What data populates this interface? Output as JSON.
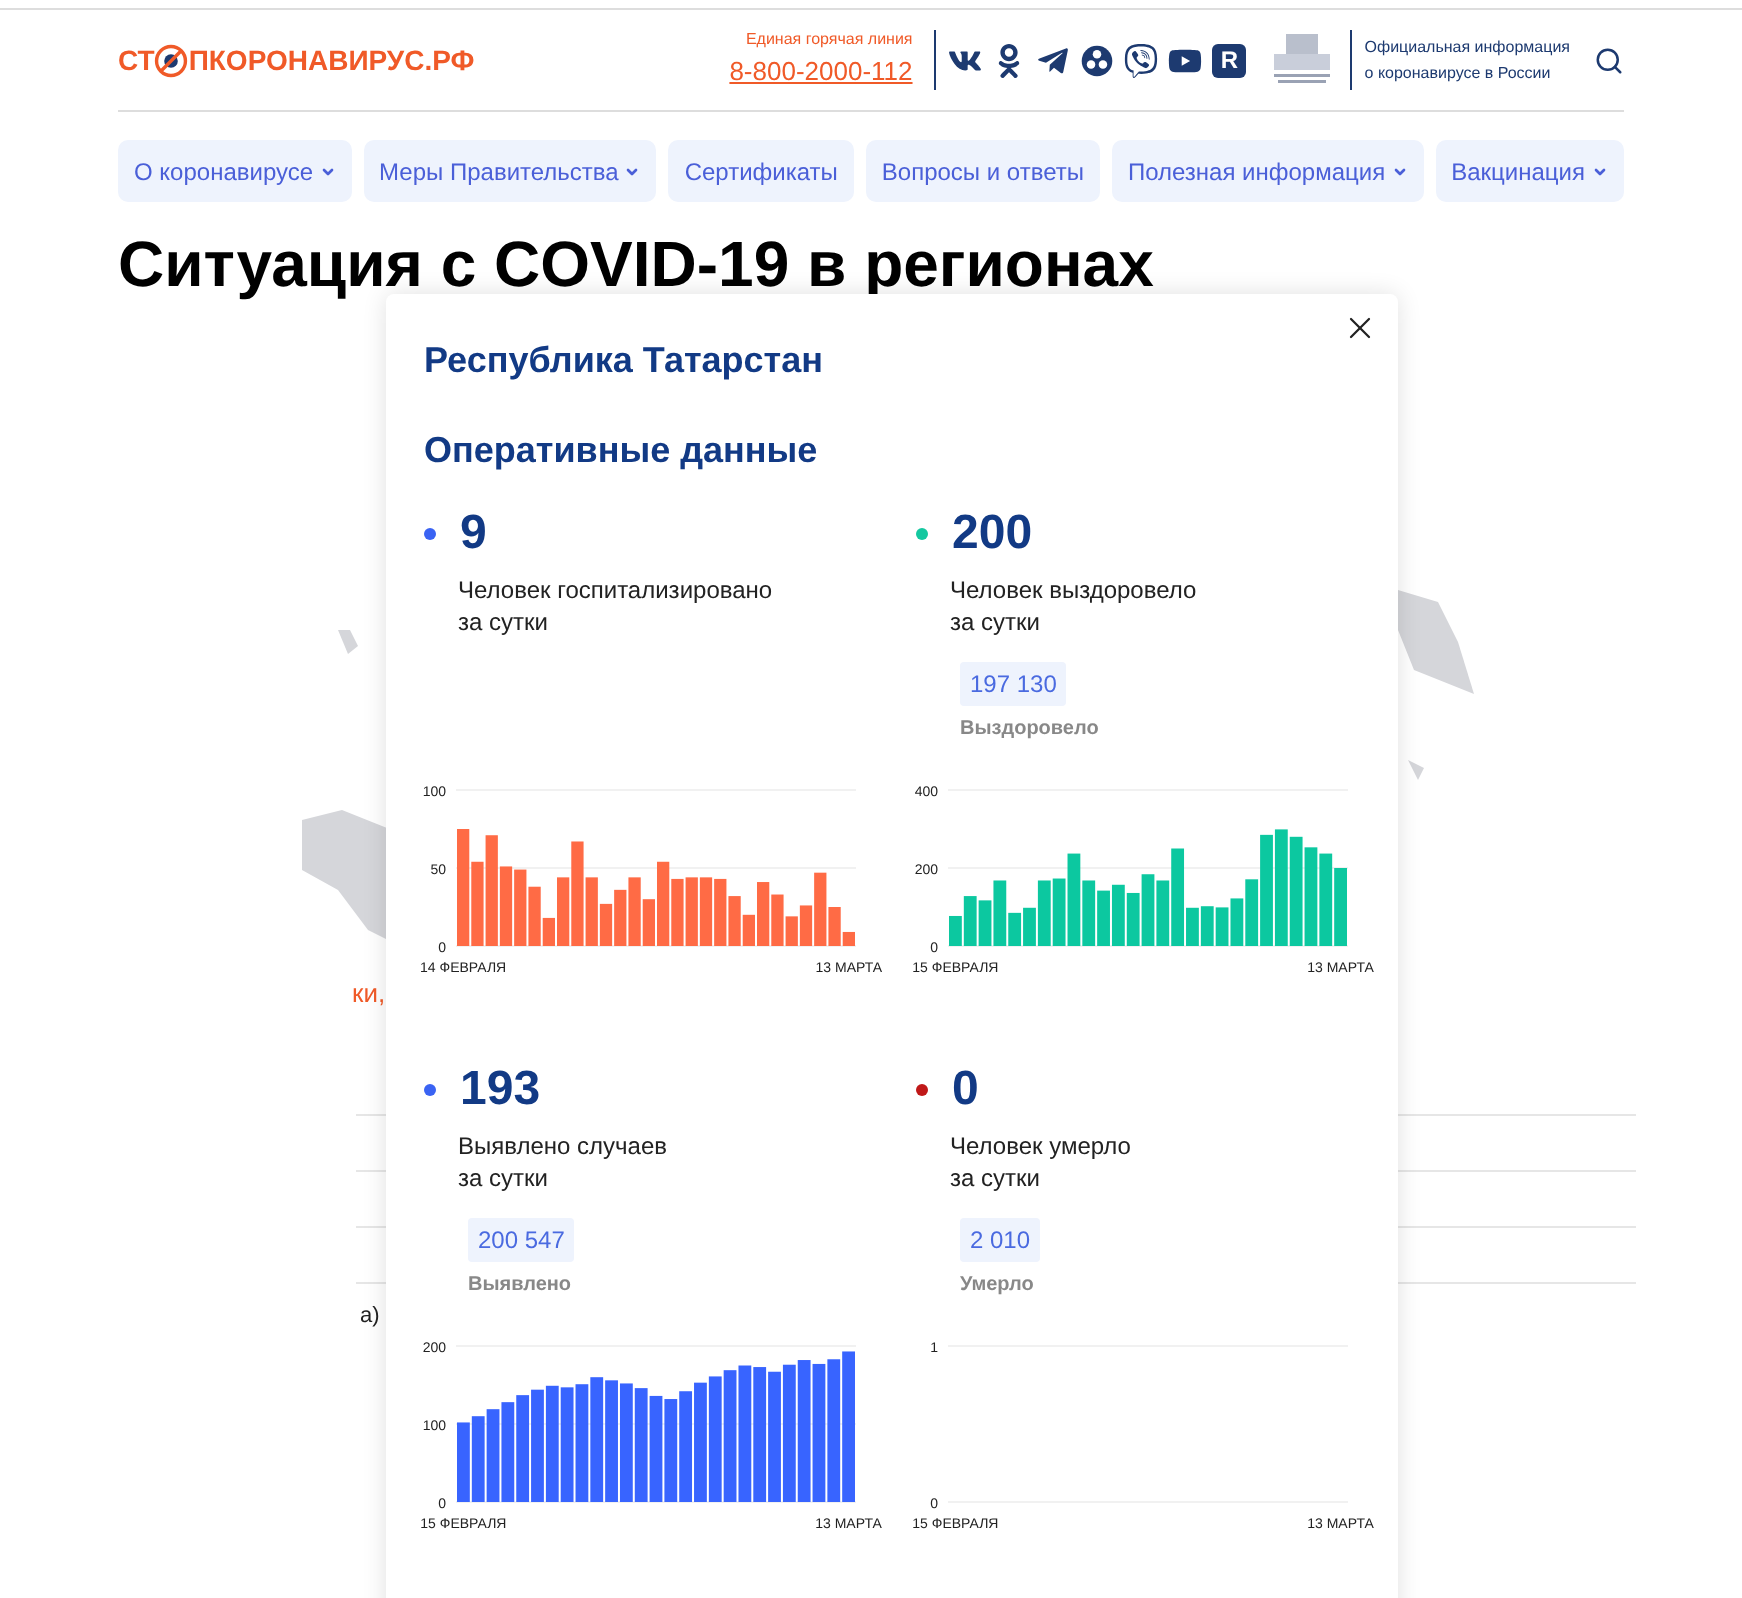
{
  "header": {
    "logo": {
      "start": "СТ",
      "rest": "ПКОРОНАВИРУС.РФ"
    },
    "hotline": {
      "label": "Единая горячая линия",
      "phone": "8-800-2000-112"
    },
    "socials": [
      {
        "kind": "vk"
      },
      {
        "kind": "ok"
      },
      {
        "kind": "telegram"
      },
      {
        "kind": "flower"
      },
      {
        "kind": "viber"
      },
      {
        "kind": "youtube"
      },
      {
        "kind": "letter",
        "text": "R"
      }
    ],
    "official_info": "Официальная информация\nо коронавирусе в России"
  },
  "nav": [
    {
      "label": "О коронавирусе",
      "dropdown": true
    },
    {
      "label": "Меры Правительства",
      "dropdown": true
    },
    {
      "label": "Сертификаты",
      "dropdown": false
    },
    {
      "label": "Вопросы и ответы",
      "dropdown": false
    },
    {
      "label": "Полезная информация",
      "dropdown": true
    },
    {
      "label": "Вакцинация",
      "dropdown": true
    }
  ],
  "page_title": "Ситуация с COVID-19 в регионах",
  "background_fragments": [
    "ки,",
    "а)"
  ],
  "modal": {
    "title": "Республика Татарстан",
    "section": "Оперативные данные",
    "stats": [
      {
        "number": "9",
        "label": "Человек госпитализировано\nза сутки",
        "color": "#3a63f3",
        "chart_data": {
          "type": "bar",
          "ylim": [
            0,
            100
          ],
          "yticks": [
            0,
            50,
            100
          ],
          "categories": [
            "14 ФЕВРАЛЯ",
            null,
            null,
            null,
            null,
            null,
            null,
            null,
            null,
            null,
            null,
            null,
            null,
            null,
            null,
            null,
            null,
            null,
            null,
            null,
            null,
            null,
            null,
            null,
            null,
            null,
            null,
            "13 МАРТА"
          ],
          "series": [
            {
              "color": "#ff6b45",
              "values": [
                75,
                54,
                71,
                51,
                49,
                38,
                18,
                44,
                67,
                44,
                27,
                36,
                44,
                30,
                54,
                43,
                44,
                44,
                43,
                32,
                20,
                41,
                33,
                19,
                26,
                47,
                25,
                9
              ]
            }
          ]
        }
      },
      {
        "number": "200",
        "label": "Человек выздоровело\nза сутки",
        "color": "#14c8a0",
        "total": "197 130",
        "total_label": "Выздоровело",
        "chart_data": {
          "type": "bar",
          "ylim": [
            0,
            400
          ],
          "yticks": [
            0,
            200,
            400
          ],
          "categories": [
            "15 ФЕВРАЛЯ",
            null,
            null,
            null,
            null,
            null,
            null,
            null,
            null,
            null,
            null,
            null,
            null,
            null,
            null,
            null,
            null,
            null,
            null,
            null,
            null,
            null,
            null,
            null,
            null,
            null,
            "13 МАРТА"
          ],
          "series": [
            {
              "color": "#0cc8a0",
              "values": [
                77,
                128,
                117,
                168,
                85,
                98,
                168,
                173,
                237,
                168,
                142,
                157,
                136,
                184,
                168,
                250,
                98,
                102,
                99,
                122,
                171,
                285,
                299,
                280,
                253,
                237,
                200
              ]
            }
          ]
        }
      },
      {
        "number": "193",
        "label": "Выявлено случаев\nза сутки",
        "color": "#3a63f3",
        "total": "200 547",
        "total_label": "Выявлено",
        "chart_data": {
          "type": "bar",
          "ylim": [
            0,
            200
          ],
          "yticks": [
            0,
            100,
            200
          ],
          "categories": [
            "15 ФЕВРАЛЯ",
            null,
            null,
            null,
            null,
            null,
            null,
            null,
            null,
            null,
            null,
            null,
            null,
            null,
            null,
            null,
            null,
            null,
            null,
            null,
            null,
            null,
            null,
            null,
            null,
            null,
            "13 МАРТА"
          ],
          "series": [
            {
              "color": "#3864ff",
              "values": [
                102,
                110,
                119,
                128,
                137,
                144,
                149,
                147,
                151,
                160,
                156,
                152,
                146,
                136,
                132,
                142,
                153,
                161,
                169,
                175,
                173,
                167,
                176,
                182,
                177,
                183,
                193
              ]
            }
          ]
        }
      },
      {
        "number": "0",
        "label": "Человек умерло\nза сутки",
        "color": "#c01818",
        "total": "2 010",
        "total_label": "Умерло",
        "chart_data": {
          "type": "bar",
          "ylim": [
            0,
            1
          ],
          "yticks": [
            0,
            1
          ],
          "categories": [
            "15 ФЕВРАЛЯ",
            null,
            null,
            null,
            null,
            null,
            null,
            null,
            null,
            null,
            null,
            null,
            null,
            null,
            null,
            null,
            null,
            null,
            null,
            null,
            null,
            null,
            null,
            null,
            null,
            null,
            "13 МАРТА"
          ],
          "series": [
            {
              "color": "#333333",
              "values": [
                0,
                0,
                0,
                0,
                0,
                0,
                0,
                0,
                0,
                0,
                0,
                0,
                0,
                0,
                0,
                0,
                0,
                0,
                0,
                0,
                0,
                0,
                0,
                0,
                0,
                0,
                0
              ]
            }
          ]
        }
      }
    ]
  }
}
